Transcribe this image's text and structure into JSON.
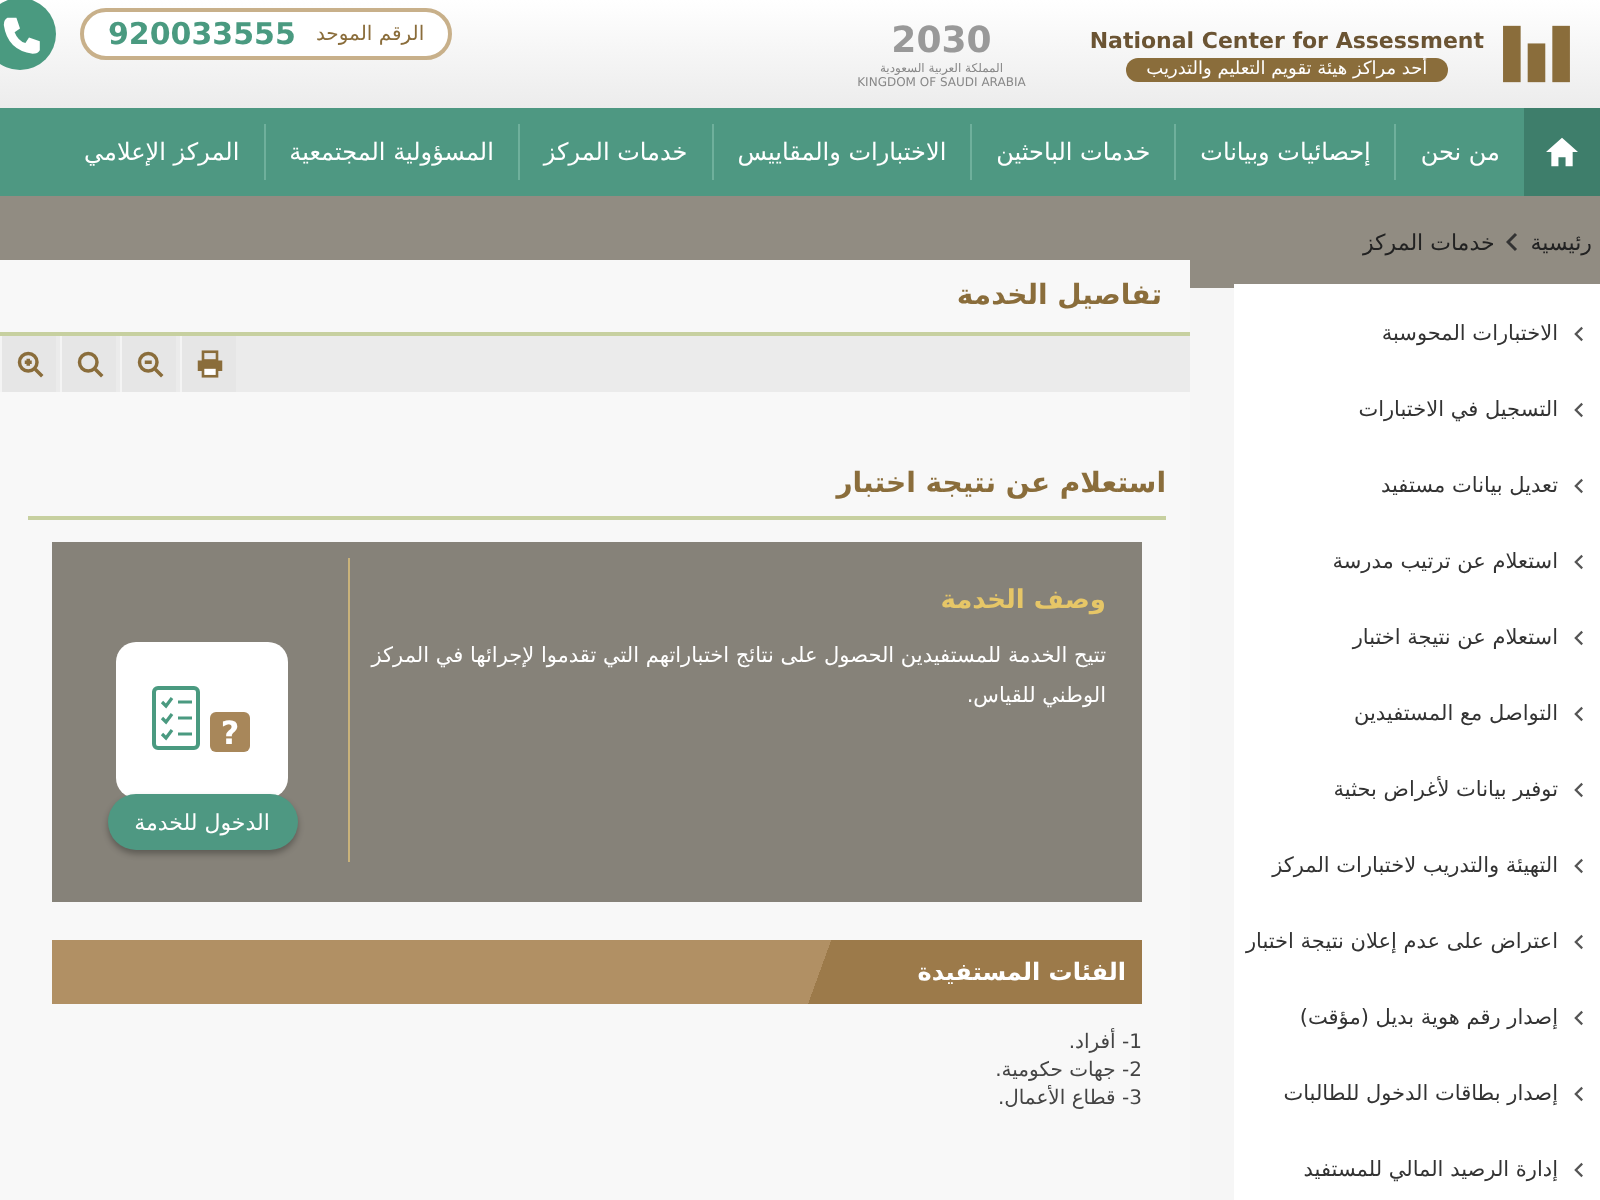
{
  "header": {
    "org_name": "National Center for Assessment",
    "org_tagline": "أحد مراكز هيئة تقويم التعليم والتدريب",
    "vision_year": "2030",
    "vision_country_ar": "المملكة العربية السعودية",
    "vision_country_en": "KINGDOM OF SAUDI ARABIA",
    "phone_label": "الرقم الموحد",
    "phone_number": "920033555"
  },
  "nav": {
    "items": [
      "من نحن",
      "إحصائيات وبيانات",
      "خدمات الباحثين",
      "الاختبارات والمقاييس",
      "خدمات المركز",
      "المسؤولية المجتمعية",
      "المركز الإعلامي"
    ]
  },
  "breadcrumb": [
    "رئيسية",
    "خدمات المركز"
  ],
  "panel": {
    "title": "تفاصيل الخدمة",
    "toolbar": [
      {
        "kind": "zoom-in"
      },
      {
        "kind": "search"
      },
      {
        "kind": "zoom-out"
      },
      {
        "kind": "print"
      }
    ]
  },
  "service": {
    "title": "استعلام عن نتيجة اختبار",
    "description_heading": "وصف الخدمة",
    "description": "تتيح الخدمة للمستفيدين الحصول على نتائج اختباراتهم التي تقدموا لإجرائها في المركز الوطني للقياس.",
    "button": "الدخول للخدمة",
    "icon_mark": "?"
  },
  "beneficiaries": {
    "heading": "الفئات المستفيدة",
    "items": [
      "1- أفراد.",
      "2- جهات حكومية.",
      "3- قطاع الأعمال."
    ]
  },
  "sidebar": {
    "items": [
      "الاختبارات المحوسبة",
      "التسجيل في الاختبارات",
      "تعديل بيانات مستفيد",
      "استعلام عن ترتيب مدرسة",
      "استعلام عن نتيجة اختبار",
      "التواصل مع المستفيدين",
      "توفير بيانات لأغراض بحثية",
      "التهيئة والتدريب لاختبارات المركز",
      "اعتراض على عدم إعلان نتيجة اختبار",
      "إصدار رقم هوية بديل (مؤقت)",
      "إصدار بطاقات الدخول للطالبات",
      "إدارة الرصيد المالي للمستفيد"
    ]
  }
}
